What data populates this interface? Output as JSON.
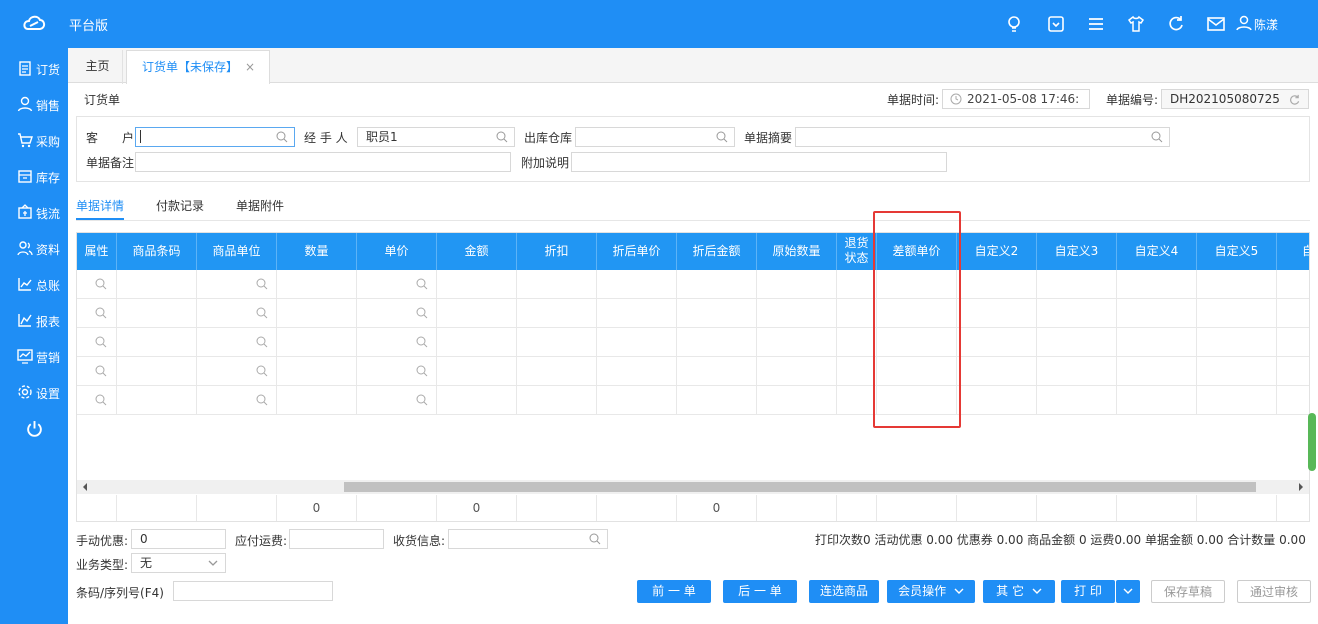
{
  "app": {
    "brand": "平台版",
    "user": "陈漾"
  },
  "sidebar": {
    "items": [
      {
        "label": "订货",
        "icon": "clipboard-icon"
      },
      {
        "label": "销售",
        "icon": "user-icon"
      },
      {
        "label": "采购",
        "icon": "cart-icon"
      },
      {
        "label": "库存",
        "icon": "box-icon"
      },
      {
        "label": "钱流",
        "icon": "wallet-icon"
      },
      {
        "label": "资料",
        "icon": "people-icon"
      },
      {
        "label": "总账",
        "icon": "chart-icon"
      },
      {
        "label": "报表",
        "icon": "report-icon"
      },
      {
        "label": "营销",
        "icon": "monitor-icon"
      },
      {
        "label": "设置",
        "icon": "gear-icon"
      }
    ]
  },
  "tabs": {
    "home": "主页",
    "active": "订货单【未保存】",
    "close": "×"
  },
  "page": {
    "title": "订货单",
    "time_label": "单据时间:",
    "time_value": "2021-05-08 17:46:",
    "number_label": "单据编号:",
    "number_value": "DH202105080725"
  },
  "form": {
    "customer_label": "客　　户",
    "handler_label": "经 手 人",
    "handler_value": "职员1",
    "warehouse_label": "出库仓库",
    "summary_label": "单据摘要",
    "remark_label": "单据备注",
    "extra_label": "附加说明"
  },
  "subtabs": [
    "单据详情",
    "付款记录",
    "单据附件"
  ],
  "table": {
    "headers": [
      "属性",
      "商品条码",
      "商品单位",
      "数量",
      "单价",
      "金额",
      "折扣",
      "折后单价",
      "折后金额",
      "原始数量",
      "退货状态",
      "差额单价",
      "自定义2",
      "自定义3",
      "自定义4",
      "自定义5",
      "自"
    ],
    "sums": {
      "qty": "0",
      "amount": "0",
      "disc_amount": "0"
    }
  },
  "bottom": {
    "manual_discount_label": "手动优惠:",
    "manual_discount_value": "0",
    "freight_label": "应付运费:",
    "receive_label": "收货信息:",
    "biz_type_label": "业务类型:",
    "biz_type_value": "无",
    "barcode_label": "条码/序列号(F4)",
    "stats": "打印次数0  活动优惠 0.00  优惠券 0.00  商品金额 0  运费0.00  单据金额 0.00  合计数量 0.00"
  },
  "buttons": {
    "prev": "前 一 单",
    "next": "后 一 单",
    "pick": "连选商品",
    "member": "会员操作",
    "other": "其 它",
    "print": "打 印",
    "save_draft": "保存草稿",
    "approve": "通过审核"
  }
}
